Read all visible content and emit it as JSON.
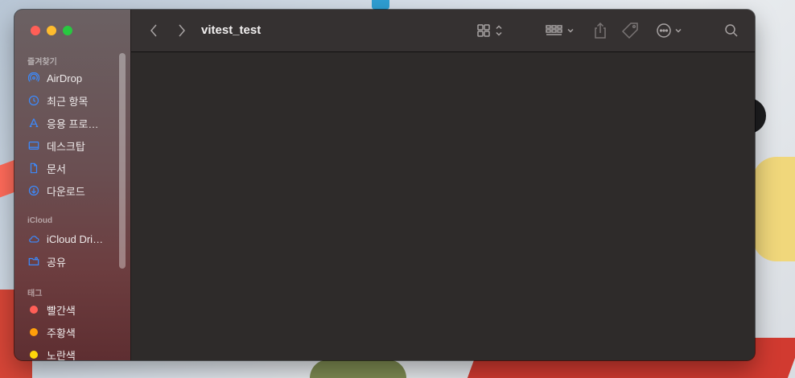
{
  "window": {
    "title": "vitest_test"
  },
  "sidebar": {
    "favorites_title": "즐겨찾기",
    "favorites": [
      {
        "label": "AirDrop",
        "icon": "airdrop-icon"
      },
      {
        "label": "최근 항목",
        "icon": "clock-icon"
      },
      {
        "label": "응용 프로…",
        "icon": "applications-icon"
      },
      {
        "label": "데스크탑",
        "icon": "desktop-icon"
      },
      {
        "label": "문서",
        "icon": "document-icon"
      },
      {
        "label": "다운로드",
        "icon": "download-icon"
      }
    ],
    "icloud_title": "iCloud",
    "icloud": [
      {
        "label": "iCloud Dri…",
        "icon": "cloud-icon"
      },
      {
        "label": "공유",
        "icon": "shared-folder-icon"
      }
    ],
    "tags_title": "태그",
    "tags": [
      {
        "label": "빨간색",
        "color": "#ff5f57"
      },
      {
        "label": "주황색",
        "color": "#ff9f0a"
      },
      {
        "label": "노란색",
        "color": "#ffd60a"
      }
    ]
  },
  "toolbar": {
    "icons": [
      "back-icon",
      "forward-icon",
      "view-grid-icon",
      "group-icon",
      "share-icon",
      "tag-icon",
      "more-icon",
      "search-icon"
    ]
  },
  "colors": {
    "accent": "#3b8bff",
    "icon": "#a7a2a2"
  }
}
